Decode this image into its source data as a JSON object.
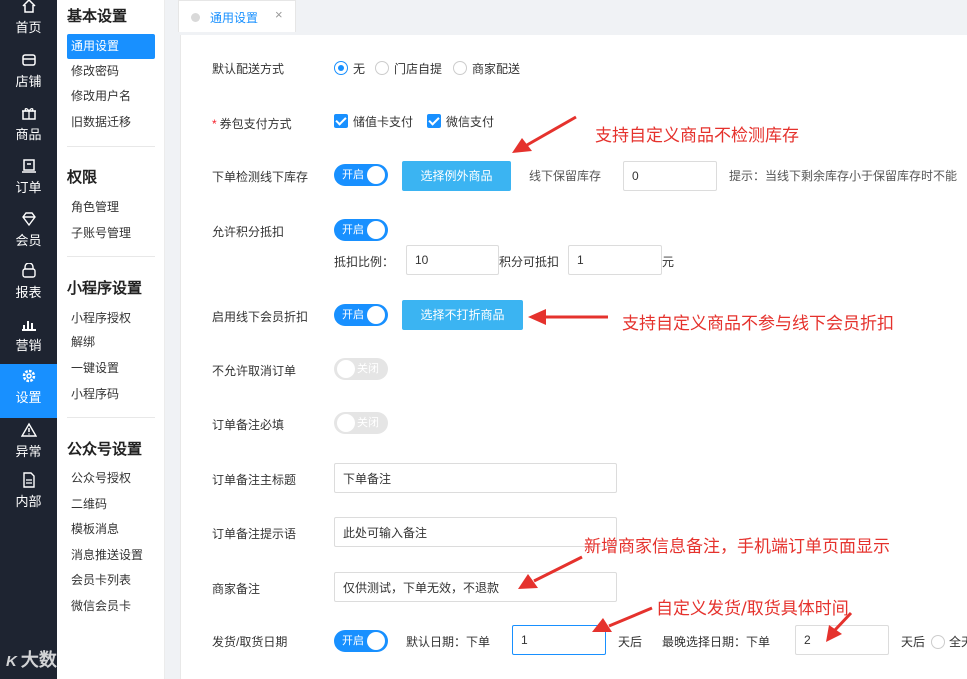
{
  "rail": {
    "items": [
      {
        "label": "首页",
        "icon": "home-icon"
      },
      {
        "label": "店铺",
        "icon": "store-icon"
      },
      {
        "label": "商品",
        "icon": "gift-icon"
      },
      {
        "label": "订单",
        "icon": "order-icon"
      },
      {
        "label": "会员",
        "icon": "member-icon"
      },
      {
        "label": "报表",
        "icon": "report-icon"
      },
      {
        "label": "营销",
        "icon": "marketing-icon"
      },
      {
        "label": "设置",
        "icon": "settings-icon",
        "active": true
      },
      {
        "label": "异常",
        "icon": "warning-icon"
      },
      {
        "label": "内部",
        "icon": "document-icon"
      }
    ]
  },
  "submenu": {
    "groups": [
      {
        "title": "基本设置",
        "items": [
          "通用设置",
          "修改密码",
          "修改用户名",
          "旧数据迁移"
        ]
      },
      {
        "title": "权限",
        "items": [
          "角色管理",
          "子账号管理"
        ]
      },
      {
        "title": "小程序设置",
        "items": [
          "小程序授权",
          "解绑",
          "一键设置",
          "小程序码"
        ]
      },
      {
        "title": "公众号设置",
        "items": [
          "公众号授权",
          "二维码",
          "模板消息",
          "消息推送设置",
          "会员卡列表",
          "微信会员卡"
        ]
      }
    ],
    "active_item": "通用设置"
  },
  "watermark": {
    "logo": "K",
    "text": "大数跨境"
  },
  "tabs": [
    {
      "label": "通用设置",
      "close": "×"
    }
  ],
  "form": {
    "delivery": {
      "label": "默认配送方式",
      "options": [
        "无",
        "门店自提",
        "商家配送"
      ],
      "selected": "无"
    },
    "coupon_pay": {
      "label": "券包支付方式",
      "required_mark": "*",
      "options": [
        "储值卡支付",
        "微信支付"
      ]
    },
    "stock_check": {
      "label": "下单检测线下库存",
      "switch": "开启",
      "button": "选择例外商品",
      "reserve_label": "线下保留库存",
      "reserve_value": "0",
      "hint": "提示：当线下剩余库存小于保留库存时不能"
    },
    "points": {
      "label": "允许积分抵扣",
      "switch": "开启",
      "ratio_label": "抵扣比例：",
      "ratio_value": "10",
      "mid_text": "积分可抵扣",
      "yuan_value": "1",
      "unit": "元"
    },
    "member_discount": {
      "label": "启用线下会员折扣",
      "switch": "开启",
      "button": "选择不打折商品"
    },
    "no_cancel": {
      "label": "不允许取消订单",
      "switch": "关闭"
    },
    "remark_required": {
      "label": "订单备注必填",
      "switch": "关闭"
    },
    "remark_title": {
      "label": "订单备注主标题",
      "value": "下单备注"
    },
    "remark_hint": {
      "label": "订单备注提示语",
      "value": "此处可输入备注"
    },
    "merchant_remark": {
      "label": "商家备注",
      "value": "仅供测试，下单无效，不退款"
    },
    "ship_date": {
      "label": "发货/取货日期",
      "switch": "开启",
      "default_label": "默认日期：下单",
      "default_value": "1",
      "after1": "天后",
      "latest_label": "最晚选择日期：下单",
      "latest_value": "2",
      "after2": "天后",
      "tail": "全天"
    }
  },
  "annotations": {
    "a1": "支持自定义商品不检测库存",
    "a2": "支持自定义商品不参与线下会员折扣",
    "a3": "新增商家信息备注，手机端订单页面显示",
    "a4": "自定义发货/取货具体时间"
  },
  "colors": {
    "primary": "#1890ff",
    "button": "#3bb4f2",
    "annotation": "#e5322d",
    "rail": "#1e2431"
  }
}
